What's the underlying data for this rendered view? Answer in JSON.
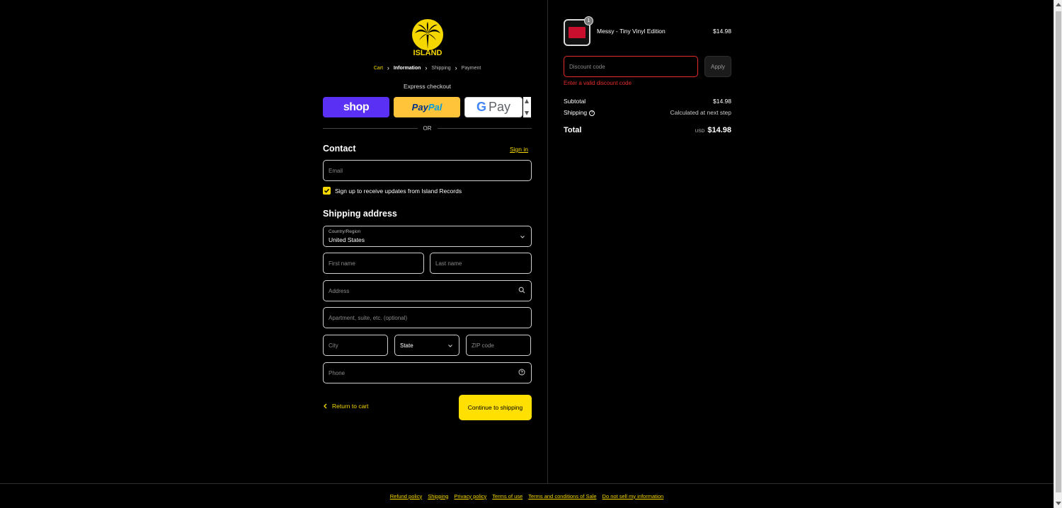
{
  "brand": {
    "logo_text": "ISLAND",
    "accent_color": "#f5d700",
    "error_color": "#e32c2b"
  },
  "breadcrumb": [
    {
      "label": "Cart",
      "state": "link"
    },
    {
      "label": "Information",
      "state": "current"
    },
    {
      "label": "Shipping",
      "state": "upcoming"
    },
    {
      "label": "Payment",
      "state": "upcoming"
    }
  ],
  "express": {
    "title": "Express checkout",
    "shop_label": "shop",
    "paypal_label_1": "Pay",
    "paypal_label_2": "Pal",
    "gpay_g": "G",
    "gpay_label": "Pay",
    "or_label": "OR"
  },
  "contact": {
    "title": "Contact",
    "signin_label": "Sign in",
    "email_placeholder": "Email",
    "newsletter_label": "Sign up to receive updates from Island Records",
    "newsletter_checked": true
  },
  "shipping": {
    "title": "Shipping address",
    "country_label": "Country/Region",
    "country_value": "United States",
    "first_name_placeholder": "First name",
    "last_name_placeholder": "Last name",
    "address_placeholder": "Address",
    "apartment_placeholder": "Apartment, suite, etc. (optional)",
    "city_placeholder": "City",
    "state_value": "State",
    "zip_placeholder": "ZIP code",
    "phone_placeholder": "Phone"
  },
  "actions": {
    "return_label": "Return to cart",
    "continue_label": "Continue to shipping"
  },
  "order": {
    "product_name": "Messy - Tiny Vinyl Edition",
    "product_price": "$14.98",
    "quantity": "1",
    "discount_placeholder": "Discount code",
    "apply_label": "Apply",
    "discount_error": "Enter a valid discount code",
    "subtotal_label": "Subtotal",
    "subtotal_value": "$14.98",
    "shipping_label": "Shipping",
    "shipping_value": "Calculated at next step",
    "total_label": "Total",
    "total_currency": "USD",
    "total_value": "$14.98"
  },
  "footer": {
    "links": [
      "Refund policy",
      "Shipping",
      "Privacy policy",
      "Terms of use",
      "Terms and conditions of Sale",
      "Do not sell my information"
    ]
  }
}
